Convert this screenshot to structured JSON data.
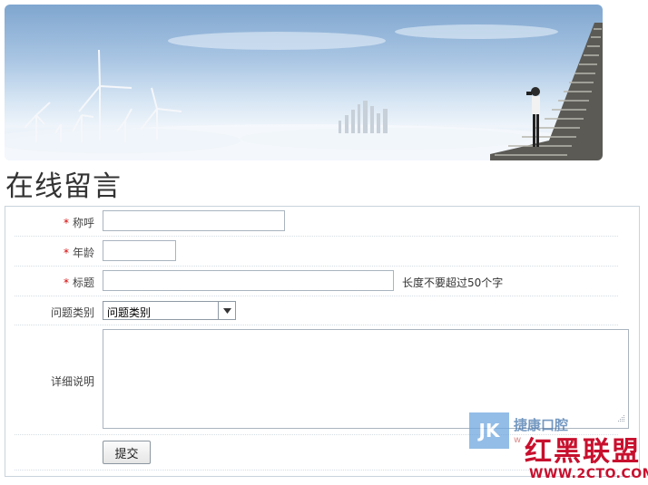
{
  "page": {
    "title": "在线留言"
  },
  "form": {
    "required_mark": "*",
    "name_label": "称呼",
    "age_label": "年龄",
    "subject_label": "标题",
    "subject_hint": "长度不要超过50个字",
    "category_label": "问题类别",
    "category_selected": "问题类别",
    "detail_label": "详细说明",
    "submit_label": "提交"
  },
  "watermark": {
    "badge": "JK",
    "badge_text": "捷康口腔",
    "badge_url": "w",
    "logo_text": "红黑联盟",
    "url_text": "WWW.2CTO.COM",
    "logo_color": "#c8102e"
  },
  "colors": {
    "required": "#d60000",
    "border": "#c9d3dc"
  }
}
